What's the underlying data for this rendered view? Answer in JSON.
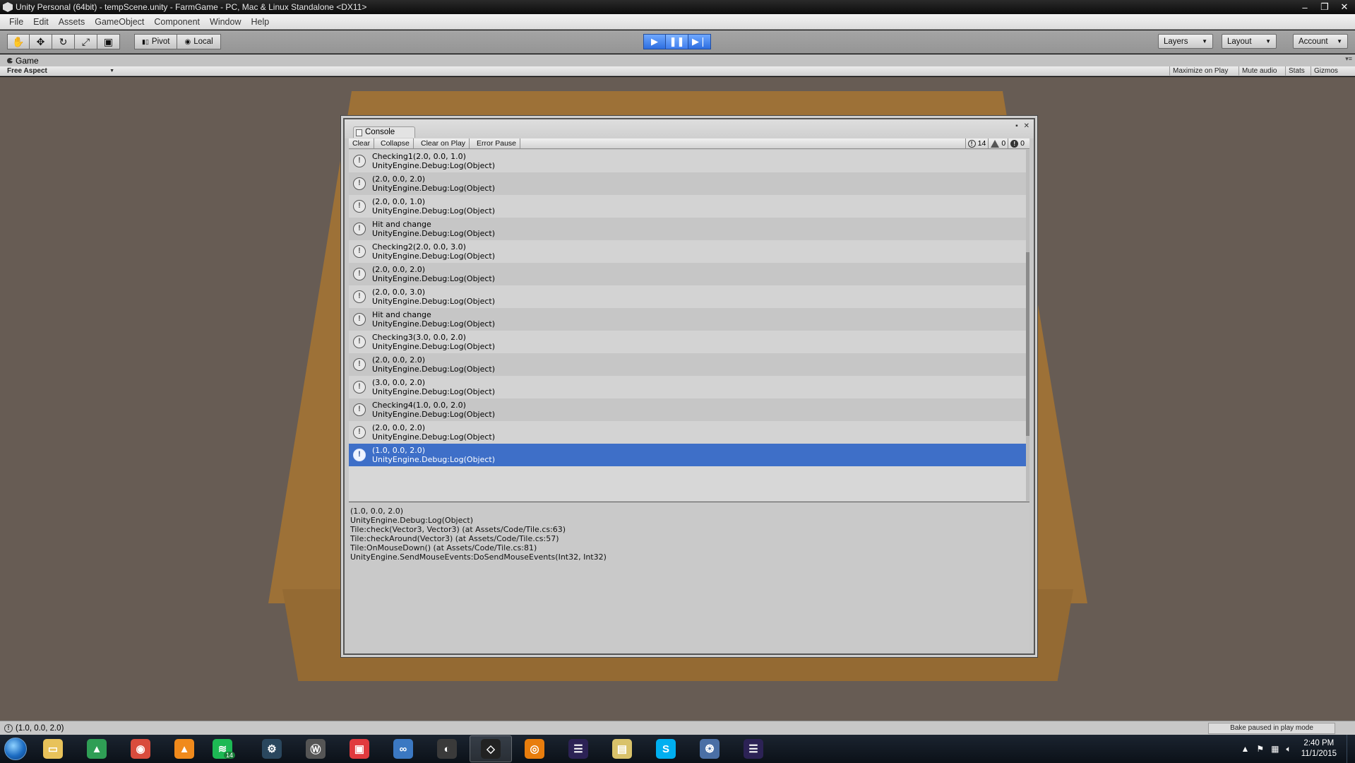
{
  "window": {
    "title": "Unity Personal (64bit) - tempScene.unity - FarmGame - PC, Mac & Linux Standalone <DX11>",
    "controls": [
      "–",
      "❐",
      "✕"
    ]
  },
  "menu": [
    "File",
    "Edit",
    "Assets",
    "GameObject",
    "Component",
    "Window",
    "Help"
  ],
  "toolbar": {
    "transform_tools": [
      "hand-icon",
      "move-icon",
      "rotate-icon",
      "scale-icon",
      "rect-tool-icon"
    ],
    "pivot_label": "Pivot",
    "local_label": "Local",
    "play_icon": "play-icon",
    "pause_icon": "pause-icon",
    "step_icon": "step-icon",
    "layers_label": "Layers",
    "layout_label": "Layout",
    "account_label": "Account"
  },
  "game_panel": {
    "tab_label": "Game",
    "aspect_label": "Free Aspect",
    "buttons": {
      "maximize": "Maximize on Play",
      "mute": "Mute audio",
      "stats": "Stats",
      "gizmos": "Gizmos"
    }
  },
  "console": {
    "tab_label": "Console",
    "toolbar": {
      "clear": "Clear",
      "collapse": "Collapse",
      "clear_on_play": "Clear on Play",
      "error_pause": "Error Pause"
    },
    "counts": {
      "info": "14",
      "warnings": "0",
      "errors": "0"
    },
    "entries": [
      {
        "line1": "Checking1(2.0, 0.0, 1.0)",
        "line2": "UnityEngine.Debug:Log(Object)"
      },
      {
        "line1": "(2.0, 0.0, 2.0)",
        "line2": "UnityEngine.Debug:Log(Object)"
      },
      {
        "line1": "(2.0, 0.0, 1.0)",
        "line2": "UnityEngine.Debug:Log(Object)"
      },
      {
        "line1": "Hit and change",
        "line2": "UnityEngine.Debug:Log(Object)"
      },
      {
        "line1": "Checking2(2.0, 0.0, 3.0)",
        "line2": "UnityEngine.Debug:Log(Object)"
      },
      {
        "line1": "(2.0, 0.0, 2.0)",
        "line2": "UnityEngine.Debug:Log(Object)"
      },
      {
        "line1": "(2.0, 0.0, 3.0)",
        "line2": "UnityEngine.Debug:Log(Object)"
      },
      {
        "line1": "Hit and change",
        "line2": "UnityEngine.Debug:Log(Object)"
      },
      {
        "line1": "Checking3(3.0, 0.0, 2.0)",
        "line2": "UnityEngine.Debug:Log(Object)"
      },
      {
        "line1": "(2.0, 0.0, 2.0)",
        "line2": "UnityEngine.Debug:Log(Object)"
      },
      {
        "line1": "(3.0, 0.0, 2.0)",
        "line2": "UnityEngine.Debug:Log(Object)"
      },
      {
        "line1": "Checking4(1.0, 0.0, 2.0)",
        "line2": "UnityEngine.Debug:Log(Object)"
      },
      {
        "line1": "(2.0, 0.0, 2.0)",
        "line2": "UnityEngine.Debug:Log(Object)"
      },
      {
        "line1": "(1.0, 0.0, 2.0)",
        "line2": "UnityEngine.Debug:Log(Object)",
        "selected": true
      }
    ],
    "detail": [
      "(1.0, 0.0, 2.0)",
      "UnityEngine.Debug:Log(Object)",
      "Tile:check(Vector3, Vector3) (at Assets/Code/Tile.cs:63)",
      "Tile:checkAround(Vector3) (at Assets/Code/Tile.cs:57)",
      "Tile:OnMouseDown() (at Assets/Code/Tile.cs:81)",
      "UnityEngine.SendMouseEvents:DoSendMouseEvents(Int32, Int32)"
    ]
  },
  "statusbar": {
    "message": "(1.0, 0.0, 2.0)",
    "bake_status": "Bake paused in play mode"
  },
  "taskbar": {
    "apps": [
      {
        "name": "explorer-icon",
        "color": "#e8c25a"
      },
      {
        "name": "google-drive-icon",
        "color": "#2f9e55"
      },
      {
        "name": "chrome-icon",
        "color": "#d94c3d"
      },
      {
        "name": "vlc-icon",
        "color": "#f08a1c"
      },
      {
        "name": "spotify-icon",
        "color": "#1db954",
        "badge": "14"
      },
      {
        "name": "steam-icon",
        "color": "#2a475e"
      },
      {
        "name": "world-of-tanks-icon",
        "color": "#555555"
      },
      {
        "name": "gamepad-icon",
        "color": "#e03a3e"
      },
      {
        "name": "visual-studio-icon",
        "color": "#3b78c2"
      },
      {
        "name": "disc-icon",
        "color": "#3a3a3a"
      },
      {
        "name": "unity-icon",
        "color": "#222222",
        "active": true
      },
      {
        "name": "blender-icon",
        "color": "#e87d0d"
      },
      {
        "name": "eclipse-icon",
        "color": "#2c2255"
      },
      {
        "name": "folder-icon",
        "color": "#d9c26a"
      },
      {
        "name": "skype-icon",
        "color": "#00aff0"
      },
      {
        "name": "network-icon",
        "color": "#4a6fa5"
      },
      {
        "name": "eclipse-icon-2",
        "color": "#2c2255"
      }
    ],
    "time": "2:40 PM",
    "date": "11/1/2015"
  }
}
